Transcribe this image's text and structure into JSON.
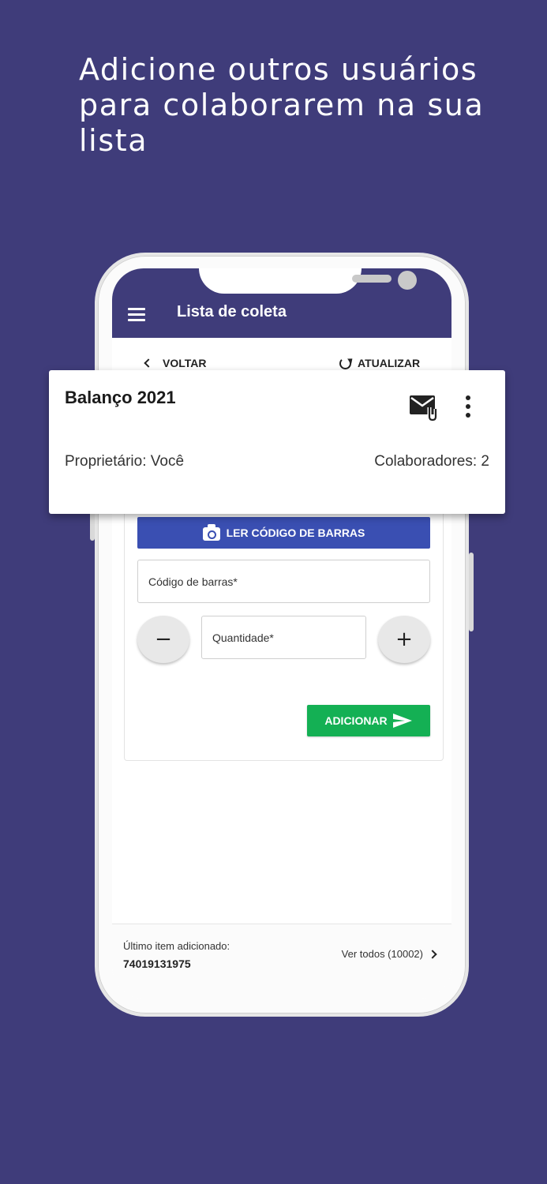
{
  "headline": "Adicione outros usuários para colaborarem na sua lista",
  "app": {
    "title": "Lista de coleta",
    "back_label": "VOLTAR",
    "refresh_label": "ATUALIZAR"
  },
  "card": {
    "title": "Balanço 2021",
    "owner": "Proprietário: Você",
    "collaborators": "Colaboradores: 2",
    "icons": [
      "mail-attachment-icon",
      "more-vert-icon"
    ]
  },
  "form": {
    "scan_label": "LER CÓDIGO DE BARRAS",
    "barcode_placeholder": "Código de barras*",
    "quantity_placeholder": "Quantidade*",
    "minus": "−",
    "plus": "+",
    "add_label": "ADICIONAR"
  },
  "footer": {
    "last_item_label": "Último item adicionado:",
    "last_item_value": "74019131975",
    "view_all": "Ver todos (10002)"
  },
  "colors": {
    "background": "#3f3c7a",
    "appbar": "#3f3c7a",
    "scan_button": "#3a4fb2",
    "add_button": "#14b054"
  }
}
